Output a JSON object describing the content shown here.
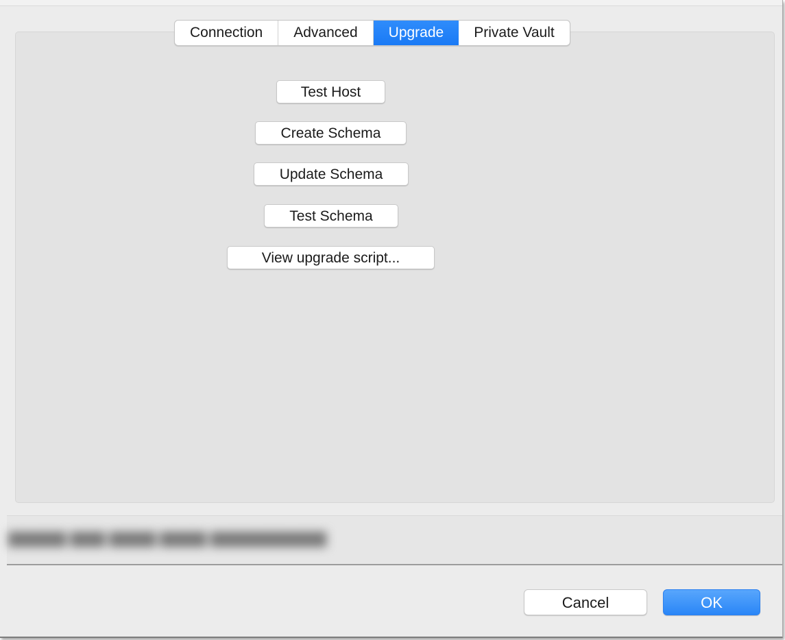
{
  "tabs": [
    {
      "label": "Connection",
      "selected": false
    },
    {
      "label": "Advanced",
      "selected": false
    },
    {
      "label": "Upgrade",
      "selected": true
    },
    {
      "label": "Private Vault",
      "selected": false
    }
  ],
  "upgrade_buttons": {
    "test_host": "Test Host",
    "create_schema": "Create Schema",
    "update_schema": "Update Schema",
    "test_schema": "Test Schema",
    "view_upgrade_script": "View upgrade script..."
  },
  "status": {
    "text": "▇▇▇▇▇ ▇▇▇ ▇▇▇▇ ▇▇▇▇ ▇▇▇▇▇▇▇▇▇▇"
  },
  "footer": {
    "cancel_label": "Cancel",
    "ok_label": "OK"
  },
  "colors": {
    "accent": "#1a7af5",
    "panel": "#e3e3e3",
    "window": "#ececec"
  }
}
